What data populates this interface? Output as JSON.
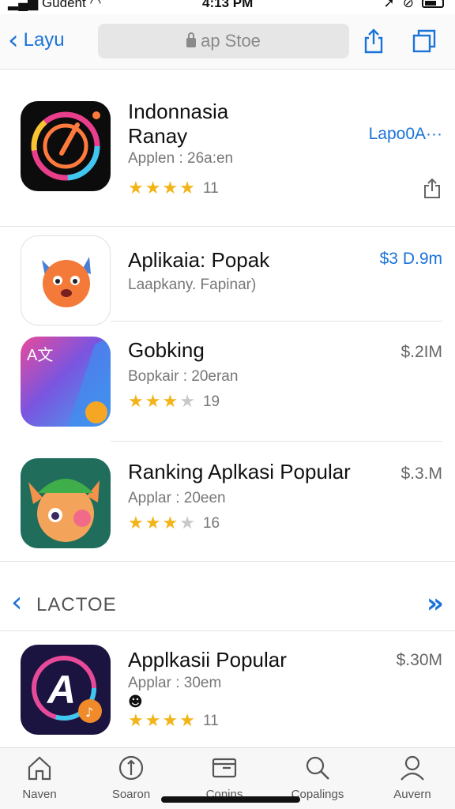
{
  "status": {
    "carrier": "Gudent",
    "time": "4:13 PM"
  },
  "nav": {
    "back_label": "Layu",
    "url": "ap Stoe"
  },
  "apps": [
    {
      "name_line1": "Indonnasia",
      "name_line2": "Ranay",
      "subtitle": "Applen : 26a:en",
      "price": "Lapo0A···",
      "rating": 4.5,
      "rating_count": "11"
    },
    {
      "name_line1": "Aplikaia: Popak",
      "subtitle": "Laapkany. Fapinar)",
      "price": "$3 D.9m"
    },
    {
      "name_line1": "Gobking",
      "subtitle": "Bopkair : 20eran",
      "price": "$.2IM",
      "rating": 3,
      "rating_count": "19"
    },
    {
      "name_line1": "Ranking Aplkasi Popular",
      "subtitle": "Applar : 20een",
      "price": "$.3.M",
      "rating": 2.5,
      "rating_count": "16"
    }
  ],
  "section": {
    "title": "LACTOE"
  },
  "featured": {
    "name_line1": "Applkasii Popular",
    "subtitle": "Applar : 30em",
    "price": "$.30M",
    "rating": 4.5,
    "rating_count": "11"
  },
  "tabs": [
    "Naven",
    "Soaron",
    "Conins",
    "Copalings",
    "Auvern"
  ],
  "colors": {
    "accent": "#1a73d9",
    "star": "#f2b418"
  }
}
